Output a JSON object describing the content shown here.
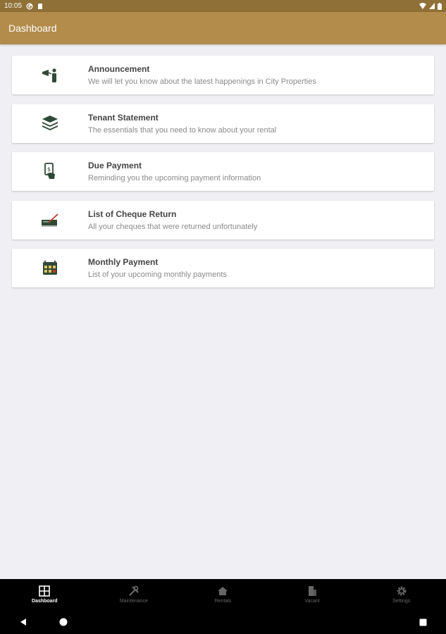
{
  "status_bar": {
    "time": "10:05"
  },
  "app_bar": {
    "title": "Dashboard"
  },
  "menu": [
    {
      "title": "Announcement",
      "subtitle": "We will let you know about the latest happenings in City Properties",
      "icon": "megaphone-person-icon"
    },
    {
      "title": "Tenant Statement",
      "subtitle": "The essentials that you need to know about your rental",
      "icon": "stack-icon"
    },
    {
      "title": "Due Payment",
      "subtitle": "Reminding you the upcoming payment information",
      "icon": "hand-money-icon"
    },
    {
      "title": "List of Cheque Return",
      "subtitle": "All your cheques that were returned unfortunately",
      "icon": "cheque-pen-icon"
    },
    {
      "title": "Monthly Payment",
      "subtitle": "List of your upcoming monthly payments",
      "icon": "calendar-money-icon"
    }
  ],
  "bottom_nav": [
    {
      "label": "Dashboard",
      "icon": "grid-icon",
      "active": true
    },
    {
      "label": "Maintenance",
      "icon": "tools-icon",
      "active": false
    },
    {
      "label": "Rentals",
      "icon": "home-icon",
      "active": false
    },
    {
      "label": "Vacant",
      "icon": "building-icon",
      "active": false
    },
    {
      "label": "Settings",
      "icon": "gear-icon",
      "active": false
    }
  ],
  "colors": {
    "status_bar": "#8f7036",
    "app_bar": "#b38b4b",
    "background": "#efeff4",
    "icon_green": "#2e4a36"
  }
}
